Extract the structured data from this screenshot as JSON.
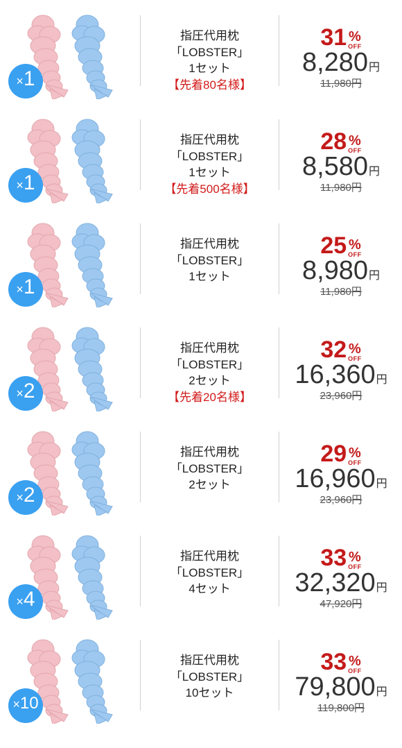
{
  "product_name": "指圧代用枕",
  "product_brand": "「LOBSTER」",
  "off_label": "OFF",
  "percent_sign": "%",
  "yen": "円",
  "colors": {
    "pink": "#f2c0c6",
    "blue": "#9ec8ef",
    "badge": "#3aa0f0",
    "discount": "#c41a1a",
    "promo": "#d21a1a"
  },
  "offers": [
    {
      "multiplier": "1",
      "sets": "1セット",
      "promo": "【先着80名様】",
      "discount": "31",
      "price": "8,280",
      "original": "11,980円"
    },
    {
      "multiplier": "1",
      "sets": "1セット",
      "promo": "【先着500名様】",
      "discount": "28",
      "price": "8,580",
      "original": "11,980円"
    },
    {
      "multiplier": "1",
      "sets": "1セット",
      "promo": "",
      "discount": "25",
      "price": "8,980",
      "original": "11,980円"
    },
    {
      "multiplier": "2",
      "sets": "2セット",
      "promo": "【先着20名様】",
      "discount": "32",
      "price": "16,360",
      "original": "23,960円"
    },
    {
      "multiplier": "2",
      "sets": "2セット",
      "promo": "",
      "discount": "29",
      "price": "16,960",
      "original": "23,960円"
    },
    {
      "multiplier": "4",
      "sets": "4セット",
      "promo": "",
      "discount": "33",
      "price": "32,320",
      "original": "47,920円"
    },
    {
      "multiplier": "10",
      "sets": "10セット",
      "promo": "",
      "discount": "33",
      "price": "79,800",
      "original": "119,800円"
    }
  ]
}
